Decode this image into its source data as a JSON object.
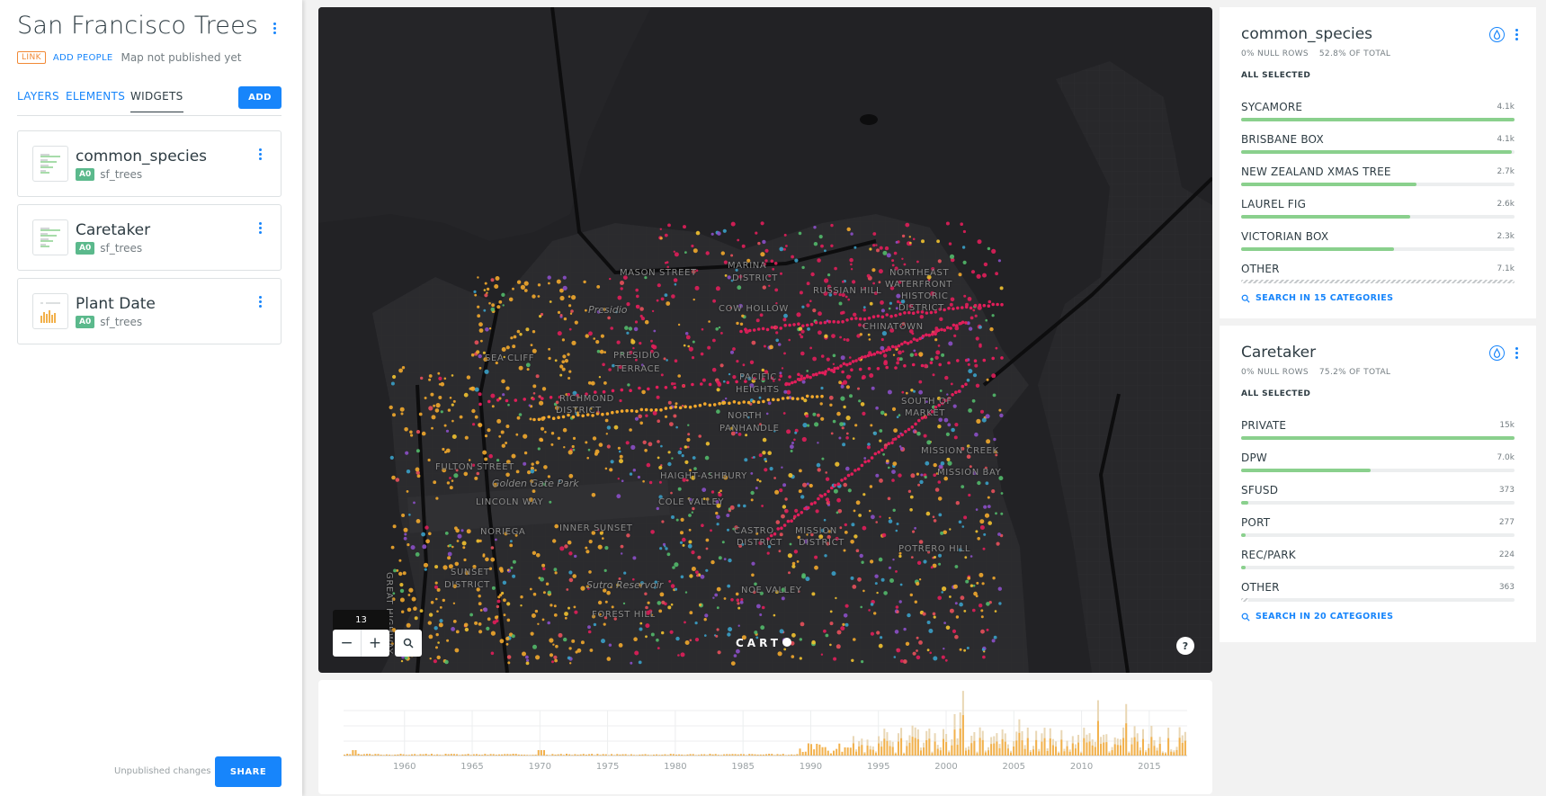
{
  "app": {
    "title": "San Francisco Trees",
    "link_badge": "LINK",
    "add_people": "ADD PEOPLE",
    "publish_status": "Map not published yet",
    "accent_color": "#1785fb"
  },
  "tabs": [
    {
      "label": "LAYERS",
      "active": false
    },
    {
      "label": "ELEMENTS",
      "active": false
    },
    {
      "label": "WIDGETS",
      "active": true
    }
  ],
  "add_button": "ADD",
  "widgets": [
    {
      "name": "common_species",
      "layer_badge": "A0",
      "source": "sf_trees",
      "thumb": "category-icon"
    },
    {
      "name": "Caretaker",
      "layer_badge": "A0",
      "source": "sf_trees",
      "thumb": "category-icon"
    },
    {
      "name": "Plant Date",
      "layer_badge": "A0",
      "source": "sf_trees",
      "thumb": "histogram-icon"
    }
  ],
  "footer": {
    "unpublished": "Unpublished changes",
    "share": "SHARE"
  },
  "map": {
    "zoom_level": "13",
    "zoom_out": "−",
    "zoom_in": "+",
    "logo": "CART",
    "help": "?",
    "labels": [
      {
        "text": "MARINA",
        "style": "caps"
      },
      {
        "text": "DISTRICT",
        "style": "caps"
      },
      {
        "text": "MASON STREET",
        "style": "caps"
      },
      {
        "text": "Presidio",
        "style": "italic"
      },
      {
        "text": "COW HOLLOW",
        "style": "caps"
      },
      {
        "text": "RUSSIAN HILL",
        "style": "caps"
      },
      {
        "text": "NORTHEAST",
        "style": "caps"
      },
      {
        "text": "WATERFRONT",
        "style": "caps"
      },
      {
        "text": "HISTORIC",
        "style": "caps"
      },
      {
        "text": "DISTRICT",
        "style": "caps"
      },
      {
        "text": "CHINATOWN",
        "style": "caps"
      },
      {
        "text": "SEA CLIFF",
        "style": "caps"
      },
      {
        "text": "PRESIDIO",
        "style": "caps"
      },
      {
        "text": "TERRACE",
        "style": "caps"
      },
      {
        "text": "PACIFIC",
        "style": "caps"
      },
      {
        "text": "HEIGHTS",
        "style": "caps"
      },
      {
        "text": "RICHMOND",
        "style": "caps"
      },
      {
        "text": "DISTRICT",
        "style": "caps"
      },
      {
        "text": "NORTH",
        "style": "caps"
      },
      {
        "text": "PANHANDLE",
        "style": "caps"
      },
      {
        "text": "SOUTH OF",
        "style": "caps"
      },
      {
        "text": "MARKET",
        "style": "caps"
      },
      {
        "text": "MISSION CREEK",
        "style": "caps"
      },
      {
        "text": "MISSION BAY",
        "style": "caps"
      },
      {
        "text": "FULTON STREET",
        "style": "caps"
      },
      {
        "text": "HAIGHT-ASHBURY",
        "style": "caps"
      },
      {
        "text": "Golden Gate Park",
        "style": "italic"
      },
      {
        "text": "LINCOLN WAY",
        "style": "caps"
      },
      {
        "text": "COLE VALLEY",
        "style": "caps"
      },
      {
        "text": "INNER SUNSET",
        "style": "caps"
      },
      {
        "text": "CASTRO",
        "style": "caps"
      },
      {
        "text": "DISTRICT",
        "style": "caps"
      },
      {
        "text": "MISSION",
        "style": "caps"
      },
      {
        "text": "DISTRICT",
        "style": "caps"
      },
      {
        "text": "POTRERO HILL",
        "style": "caps"
      },
      {
        "text": "SUNSET",
        "style": "caps"
      },
      {
        "text": "DISTRICT",
        "style": "caps"
      },
      {
        "text": "Sutro Reservoir",
        "style": "italic"
      },
      {
        "text": "NOE VALLEY",
        "style": "caps"
      },
      {
        "text": "FOREST HILL",
        "style": "caps"
      },
      {
        "text": "GREAT HIGHWAY",
        "style": "caps"
      },
      {
        "text": "NORIEGA",
        "style": "caps"
      }
    ],
    "point_colors": [
      "#e01e5a",
      "#f2a82c",
      "#8b4fc8",
      "#f2c230",
      "#52b96a",
      "#e8505b",
      "#3aa0c8"
    ]
  },
  "timeline": {
    "x_ticks": [
      "1960",
      "1965",
      "1970",
      "1975",
      "1980",
      "1985",
      "1990",
      "1995",
      "2000",
      "2005",
      "2010",
      "2015"
    ],
    "bar_color": "#f2b14c",
    "bg_bar_color": "#e9d7b5"
  },
  "right_widgets": [
    {
      "title": "common_species",
      "null_rows": "0% NULL ROWS",
      "of_total": "52.8% OF TOTAL",
      "all_selected": "ALL SELECTED",
      "categories": [
        {
          "name": "SYCAMORE",
          "value": "4.1k",
          "fraction": 1.0
        },
        {
          "name": "BRISBANE BOX",
          "value": "4.1k",
          "fraction": 0.99
        },
        {
          "name": "NEW ZEALAND XMAS TREE",
          "value": "2.7k",
          "fraction": 0.64
        },
        {
          "name": "LAUREL FIG",
          "value": "2.6k",
          "fraction": 0.62
        },
        {
          "name": "VICTORIAN BOX",
          "value": "2.3k",
          "fraction": 0.56
        },
        {
          "name": "OTHER",
          "value": "7.1k",
          "fraction": 1.0,
          "other": true
        }
      ],
      "search": "SEARCH IN 15 CATEGORIES"
    },
    {
      "title": "Caretaker",
      "null_rows": "0% NULL ROWS",
      "of_total": "75.2% OF TOTAL",
      "all_selected": "ALL SELECTED",
      "categories": [
        {
          "name": "PRIVATE",
          "value": "15k",
          "fraction": 1.0
        },
        {
          "name": "DPW",
          "value": "7.0k",
          "fraction": 0.475
        },
        {
          "name": "SFUSD",
          "value": "373",
          "fraction": 0.025
        },
        {
          "name": "PORT",
          "value": "277",
          "fraction": 0.018
        },
        {
          "name": "REC/PARK",
          "value": "224",
          "fraction": 0.015
        },
        {
          "name": "OTHER",
          "value": "363",
          "fraction": 0.025,
          "other": true
        }
      ],
      "search": "SEARCH IN 20 CATEGORIES"
    }
  ]
}
